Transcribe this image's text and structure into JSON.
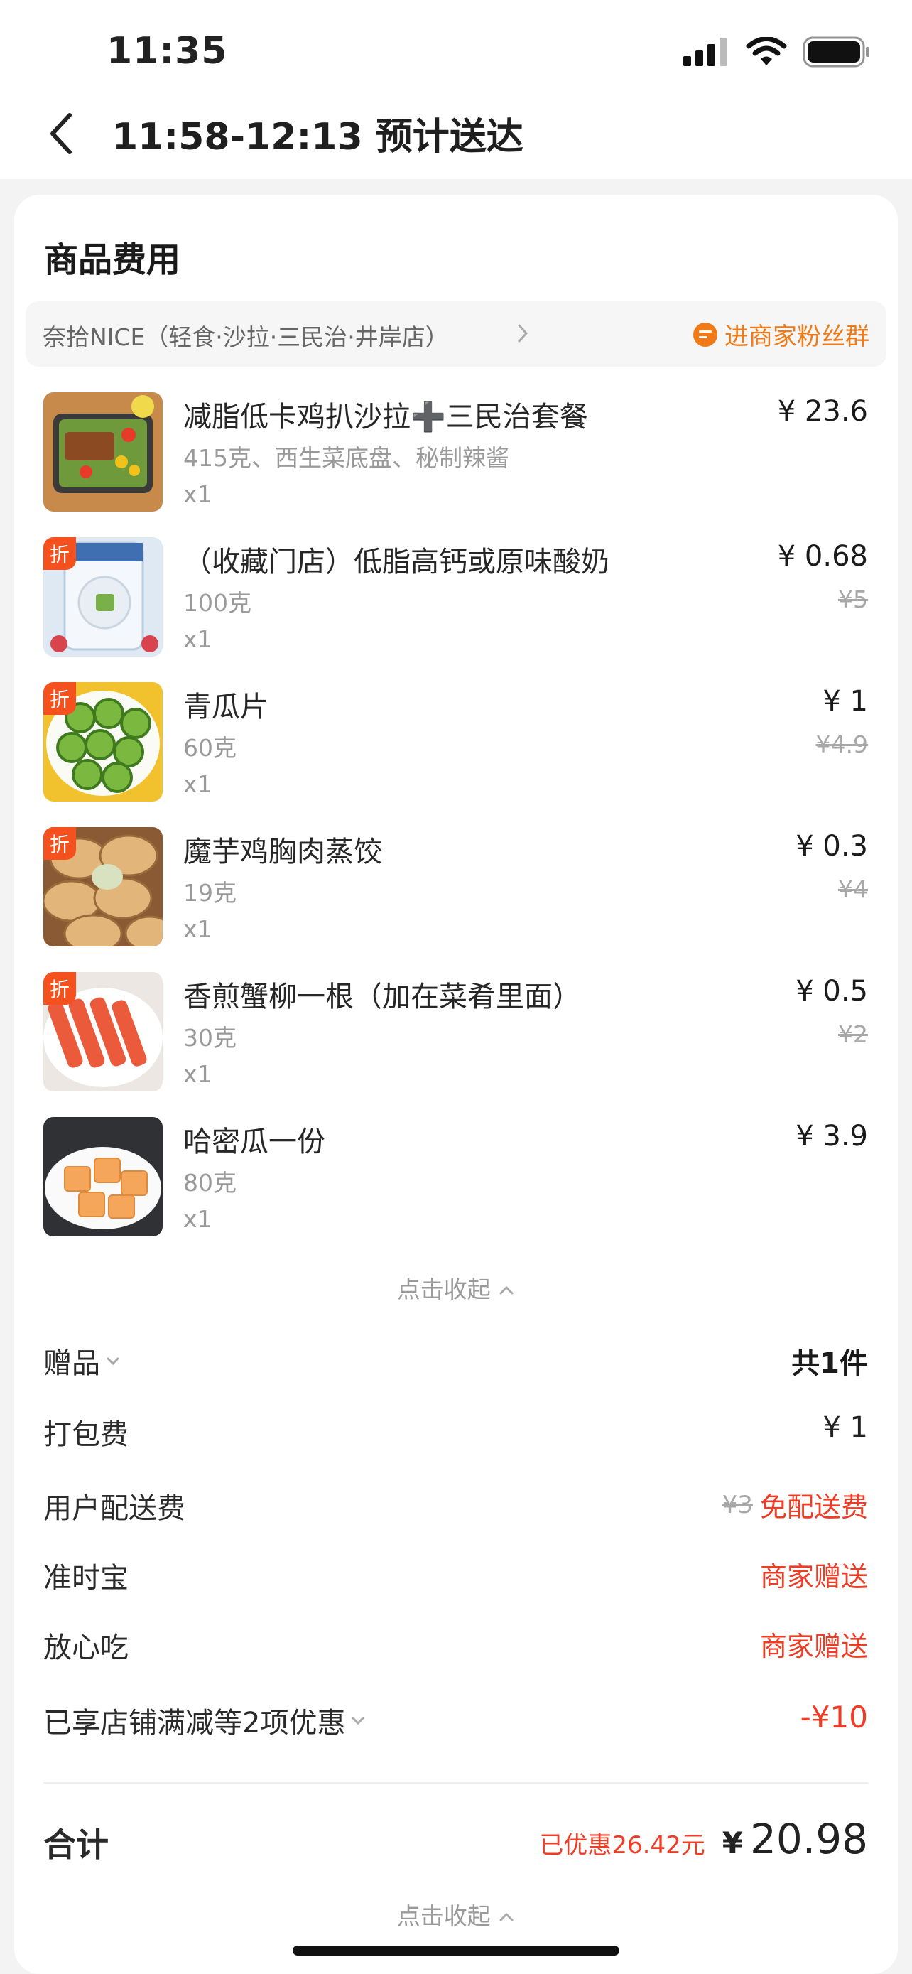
{
  "status": {
    "time": "11:35"
  },
  "nav": {
    "title": "11:58-12:13 预计送达"
  },
  "section_title": "商品费用",
  "shop": {
    "name": "奈拾NICE（轻食·沙拉·三民治·井岸店）",
    "fans_label": "进商家粉丝群"
  },
  "items": [
    {
      "name": "减脂低卡鸡扒沙拉➕三民治套餐",
      "spec": "415克、西生菜底盘、秘制辣酱",
      "qty": "x1",
      "price": "¥ 23.6",
      "orig": "",
      "badge": ""
    },
    {
      "name": "（收藏门店）低脂高钙或原味酸奶",
      "spec": "100克",
      "qty": "x1",
      "price": "¥ 0.68",
      "orig": "¥5",
      "badge": "折"
    },
    {
      "name": "青瓜片",
      "spec": "60克",
      "qty": "x1",
      "price": "¥ 1",
      "orig": "¥4.9",
      "badge": "折"
    },
    {
      "name": "魔芋鸡胸肉蒸饺",
      "spec": "19克",
      "qty": "x1",
      "price": "¥ 0.3",
      "orig": "¥4",
      "badge": "折"
    },
    {
      "name": "香煎蟹柳一根（加在菜肴里面）",
      "spec": "30克",
      "qty": "x1",
      "price": "¥ 0.5",
      "orig": "¥2",
      "badge": "折"
    },
    {
      "name": "哈密瓜一份",
      "spec": "80克",
      "qty": "x1",
      "price": "¥ 3.9",
      "orig": "",
      "badge": ""
    }
  ],
  "collapse_label": "点击收起",
  "fees": {
    "gift_label": "赠品",
    "gift_value": "共1件",
    "packing_label": "打包费",
    "packing_value": "¥ 1",
    "delivery_label": "用户配送费",
    "delivery_orig": "¥3",
    "delivery_value": "免配送费",
    "ontime_label": "准时宝",
    "ontime_value": "商家赠送",
    "safe_label": "放心吃",
    "safe_value": "商家赠送",
    "discount_label": "已享店铺满减等2项优惠",
    "discount_value": "-¥10"
  },
  "total": {
    "label": "合计",
    "saved": "已优惠26.42元",
    "currency": "¥",
    "amount": "20.98"
  },
  "colors": {
    "accent_red": "#f03c24",
    "accent_orange": "#f07a18",
    "badge": "#f4511e"
  }
}
